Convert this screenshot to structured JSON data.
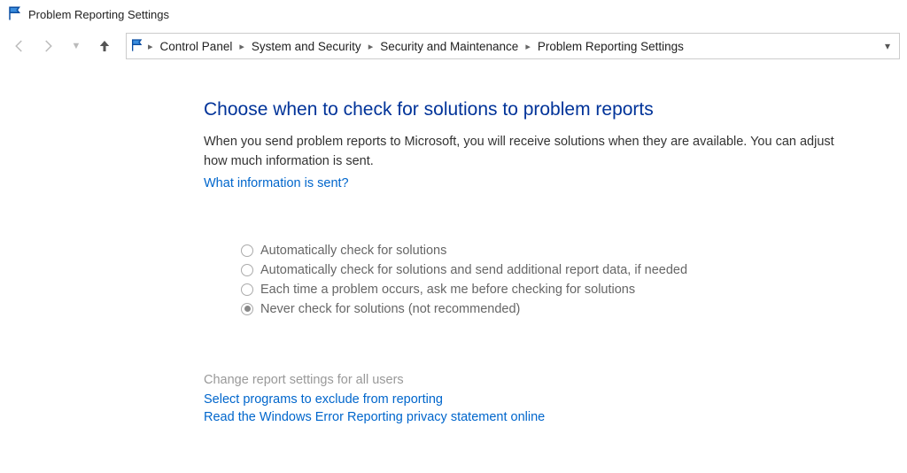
{
  "window": {
    "title": "Problem Reporting Settings"
  },
  "breadcrumbs": {
    "items": [
      {
        "label": "Control Panel"
      },
      {
        "label": "System and Security"
      },
      {
        "label": "Security and Maintenance"
      },
      {
        "label": "Problem Reporting Settings"
      }
    ]
  },
  "main": {
    "heading": "Choose when to check for solutions to problem reports",
    "description": "When you send problem reports to Microsoft, you will receive solutions when they are available. You can adjust how much information is sent.",
    "info_link": "What information is sent?",
    "options": [
      {
        "label": "Automatically check for solutions",
        "selected": false
      },
      {
        "label": "Automatically check for solutions and send additional report data, if needed",
        "selected": false
      },
      {
        "label": "Each time a problem occurs, ask me before checking for solutions",
        "selected": false
      },
      {
        "label": "Never check for solutions (not recommended)",
        "selected": true
      }
    ],
    "change_all_users": "Change report settings for all users",
    "exclude_link": "Select programs to exclude from reporting",
    "privacy_link": "Read the Windows Error Reporting privacy statement online"
  }
}
